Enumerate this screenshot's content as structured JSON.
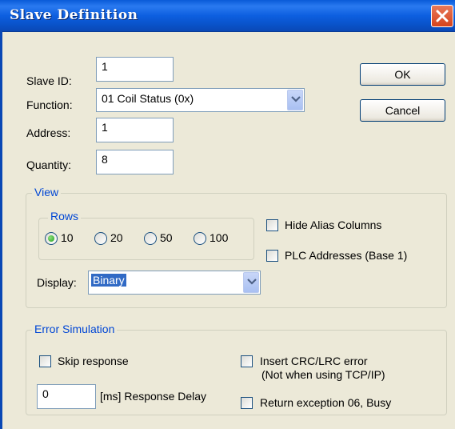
{
  "dialog": {
    "title": "Slave Definition"
  },
  "fields": {
    "slave_id": {
      "label": "Slave ID:",
      "value": "1"
    },
    "function": {
      "label": "Function:",
      "value": "01 Coil Status (0x)"
    },
    "address": {
      "label": "Address:",
      "value": "1"
    },
    "quantity": {
      "label": "Quantity:",
      "value": "8"
    }
  },
  "buttons": {
    "ok": "OK",
    "cancel": "Cancel"
  },
  "view": {
    "title": "View",
    "rows": {
      "title": "Rows",
      "options": [
        "10",
        "20",
        "50",
        "100"
      ],
      "selected": "10"
    },
    "hide_alias_columns": {
      "label": "Hide Alias Columns",
      "checked": false
    },
    "plc_addresses": {
      "label": "PLC Addresses (Base 1)",
      "checked": false
    },
    "display": {
      "label": "Display:",
      "value": "Binary"
    }
  },
  "error_simulation": {
    "title": "Error Simulation",
    "skip_response": {
      "label": "Skip response",
      "checked": false
    },
    "response_delay": {
      "value": "0",
      "label": "[ms] Response Delay"
    },
    "insert_crc": {
      "label": "Insert CRC/LRC error",
      "note": "(Not when using TCP/IP)",
      "checked": false
    },
    "return_exception": {
      "label": "Return exception 06, Busy",
      "checked": false
    }
  },
  "icons": {
    "close": "close-x-icon",
    "dropdown": "chevron-down-icon"
  },
  "colors": {
    "titlebar": "#0a5bd8",
    "close_button": "#d5431c",
    "group_title": "#0046d5",
    "selection": "#316ac5",
    "window_background": "#ece9d8"
  }
}
